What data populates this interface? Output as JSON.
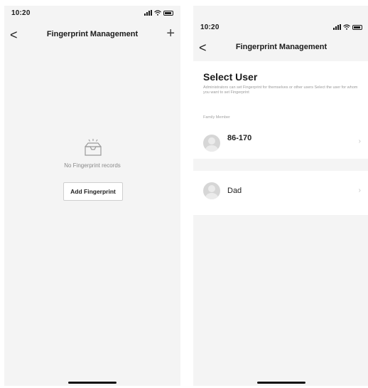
{
  "left_screen": {
    "status_time": "10:20",
    "nav": {
      "back": "<",
      "title": "Fingerprint Management",
      "add": "+"
    },
    "empty_message": "No Fingerprint records",
    "add_button_label": "Add Fingerprint"
  },
  "right_screen": {
    "status_time": "10:20",
    "nav": {
      "back": "<",
      "title": "Fingerprint Management"
    },
    "heading": "Select User",
    "description": "Administrators can set Fingerprint for themselves or other users Select the user for whom you want to set Fingerprint",
    "section_label": "Family Member",
    "users": [
      {
        "name": "86-170",
        "sub": ""
      },
      {
        "name": "Dad",
        "sub": ""
      }
    ],
    "chevron": "›"
  },
  "icons": [
    "back-icon",
    "add-icon",
    "empty-tray-icon",
    "avatar-icon",
    "chevron-right-icon",
    "wifi-icon",
    "signal-icon",
    "battery-icon"
  ]
}
